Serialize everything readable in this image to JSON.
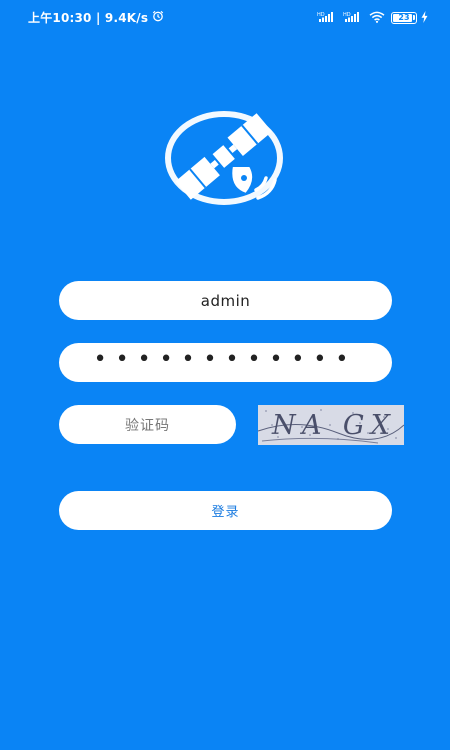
{
  "status_bar": {
    "left_text": "上午10:30 | 9.4K/s",
    "alarm_icon": "alarm-clock-icon",
    "signal_label": "HD",
    "battery_level": "23",
    "icons": [
      "signal-hd-icon",
      "signal-hd-icon",
      "wifi-icon",
      "battery-icon",
      "charging-icon"
    ]
  },
  "login": {
    "logo_icon": "satellite-icon",
    "username_value": "admin",
    "password_mask": "••••••••••••",
    "captcha_placeholder": "验证码",
    "captcha_image_text": "NA GX",
    "login_label": "登录"
  },
  "colors": {
    "background": "#0a84f5",
    "field": "#ffffff",
    "button_text": "#1a7be0"
  }
}
